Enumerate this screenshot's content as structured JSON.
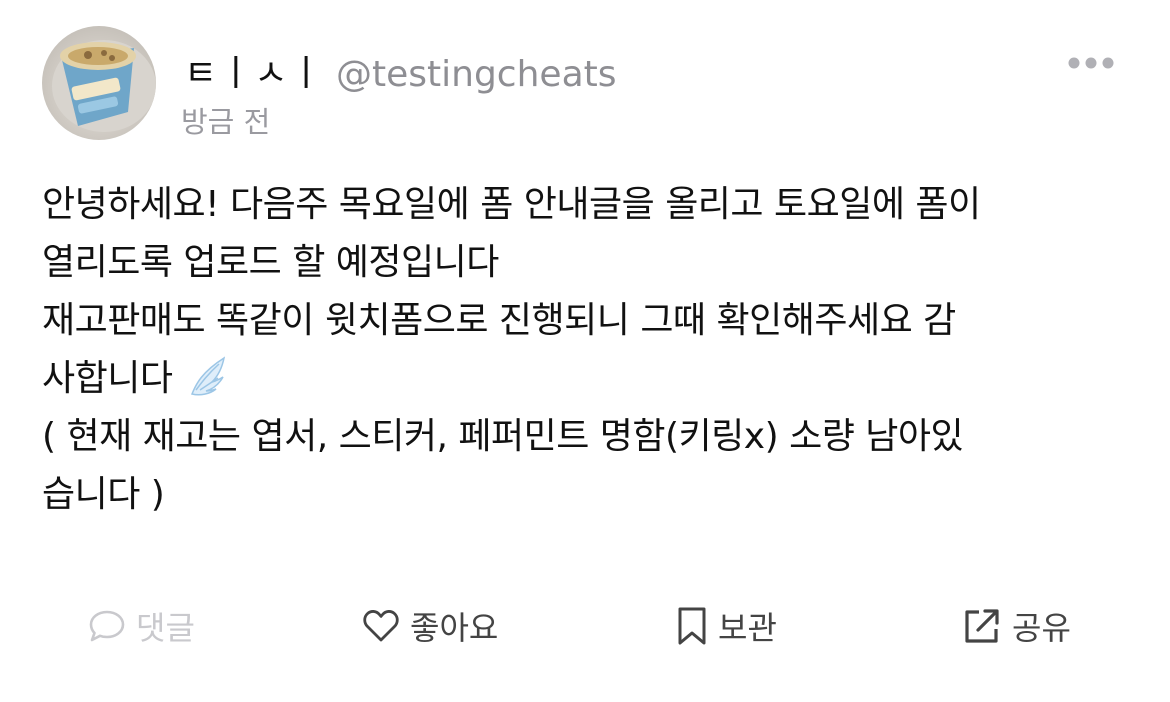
{
  "post": {
    "display_name": "ㅌㅣㅅㅣ",
    "handle": "@testingcheats",
    "timestamp": "방금 전",
    "avatar_icon": "ice-cream-cup-avatar",
    "more_icon": "more-dots-icon",
    "body_lines": [
      "안녕하세요! 다음주 목요일에 폼 안내글을 올리고 토요일에 폼이",
      "열리도록 업로드 할 예정입니다",
      "재고판매도 똑같이 윗치폼으로 진행되니 그때 확인해주세요 감",
      "사합니다",
      "( 현재 재고는 엽서, 스티커, 페퍼민트 명함(키링x) 소량 남아있",
      "습니다 )"
    ],
    "emoji_icon": "wing-emoji"
  },
  "actions": {
    "comment_label": "댓글",
    "like_label": "좋아요",
    "bookmark_label": "보관",
    "share_label": "공유"
  },
  "colors": {
    "text": "#111111",
    "muted": "#8e8e93",
    "disabled": "#c9c9cd"
  }
}
